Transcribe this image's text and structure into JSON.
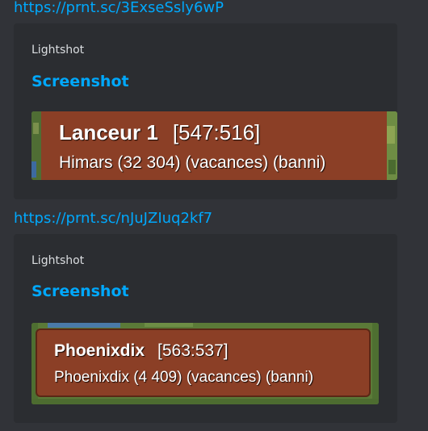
{
  "messages": [
    {
      "link": "https://prnt.sc/3ExseSsly6wP",
      "embed": {
        "provider": "Lightshot",
        "title": "Screenshot",
        "image": {
          "name": "Lanceur 1",
          "coords": "[547:516]",
          "detail": "Himars (32 304) (vacances) (banni)",
          "plate_color": "#8b3f26"
        }
      }
    },
    {
      "link": "https://prnt.sc/nJuJZIuq2kf7",
      "embed": {
        "provider": "Lightshot",
        "title": "Screenshot",
        "image": {
          "name": "Phoenixdix",
          "coords": "[563:537]",
          "detail": "Phoenixdix (4 409) (vacances) (banni)",
          "plate_color": "#8b3f26"
        }
      }
    }
  ],
  "colors": {
    "background": "#313338",
    "embed_background": "#2b2d31",
    "link": "#00a8fc",
    "provider_text": "#dbdee1"
  }
}
